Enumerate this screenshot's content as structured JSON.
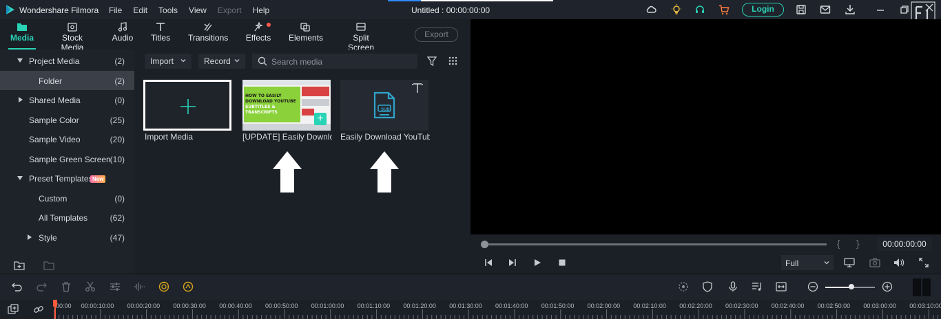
{
  "app": {
    "name": "Wondershare Filmora",
    "menu": [
      {
        "label": "File",
        "disabled": false
      },
      {
        "label": "Edit",
        "disabled": false
      },
      {
        "label": "Tools",
        "disabled": false
      },
      {
        "label": "View",
        "disabled": false
      },
      {
        "label": "Export",
        "disabled": true
      },
      {
        "label": "Help",
        "disabled": false
      }
    ],
    "document_title": "Untitled : 00:00:00:00",
    "login_label": "Login"
  },
  "media_tabs": [
    {
      "label": "Media",
      "icon": "folder-icon",
      "active": true
    },
    {
      "label": "Stock Media",
      "icon": "stock-media-icon",
      "active": false
    },
    {
      "label": "Audio",
      "icon": "music-note-icon",
      "active": false
    },
    {
      "label": "Titles",
      "icon": "titles-t-icon",
      "active": false
    },
    {
      "label": "Transitions",
      "icon": "transitions-icon",
      "active": false
    },
    {
      "label": "Effects",
      "icon": "effects-sparkle-icon",
      "active": false
    },
    {
      "label": "Elements",
      "icon": "elements-icon",
      "active": false
    },
    {
      "label": "Split Screen",
      "icon": "split-screen-icon",
      "active": false
    }
  ],
  "export_label": "Export",
  "sidebar": {
    "items": [
      {
        "label": "Project Media",
        "count": "(2)"
      },
      {
        "label": "Folder",
        "count": "(2)"
      },
      {
        "label": "Shared Media",
        "count": "(0)"
      },
      {
        "label": "Sample Color",
        "count": "(25)"
      },
      {
        "label": "Sample Video",
        "count": "(20)"
      },
      {
        "label": "Sample Green Screen",
        "count": "(10)"
      },
      {
        "label": "Preset Templates",
        "count": "",
        "badge": "New"
      },
      {
        "label": "Custom",
        "count": "(0)"
      },
      {
        "label": "All Templates",
        "count": "(62)"
      },
      {
        "label": "Style",
        "count": "(47)"
      }
    ]
  },
  "media_toolbar": {
    "import_label": "Import",
    "record_label": "Record",
    "search_placeholder": "Search media"
  },
  "media_items": [
    {
      "label": "Import Media"
    },
    {
      "label": "[UPDATE] Easily Downlo..."
    },
    {
      "label": "Easily Download YouTub..."
    }
  ],
  "thumbnail_text": {
    "line1": "HOW TO EASILY",
    "line2": "DOWNLOAD YOUTUBE",
    "line3": "SUBTITLES &",
    "line4": "TRANSCRIPTS",
    "sub_label": "SUB"
  },
  "preview": {
    "timecode": "00:00:00:00",
    "quality": "Full",
    "bracket_in": "{",
    "bracket_out": "}"
  },
  "timeline": {
    "zoom_level": 0.5,
    "ruler_labels": [
      "00:00",
      "00:00:10:00",
      "00:00:20:00",
      "00:00:30:00",
      "00:00:40:00",
      "00:00:50:00",
      "00:01:00:00",
      "00:01:10:00",
      "00:01:20:00",
      "00:01:30:00",
      "00:01:40:00",
      "00:01:50:00",
      "00:02:00:00",
      "00:02:10:00",
      "00:02:20:00",
      "00:02:30:00",
      "00:02:40:00",
      "00:02:50:00",
      "00:03:00:00",
      "00:03:10:00"
    ]
  },
  "colors": {
    "accent": "#29d3b6",
    "background": "#1b1f26",
    "playhead": "#ff5a3c"
  }
}
